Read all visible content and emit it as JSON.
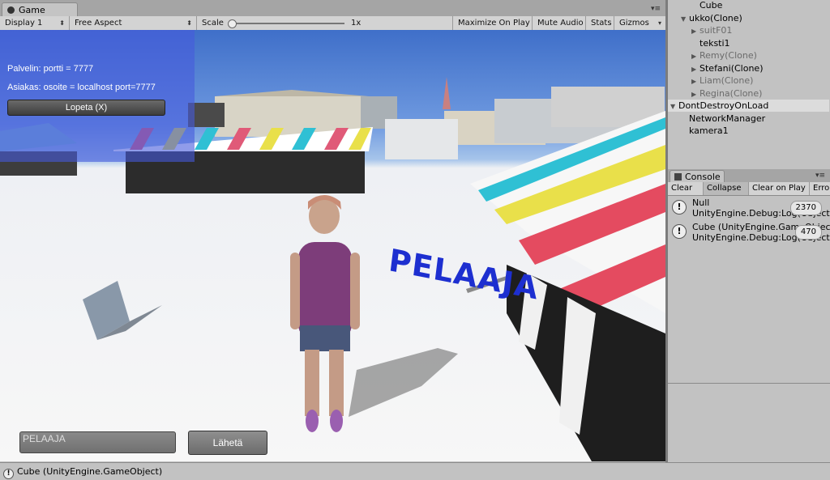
{
  "game_window": {
    "tab_label": "Game",
    "toolbar": {
      "display": "Display 1",
      "aspect": "Free Aspect",
      "scale_label": "Scale",
      "scale_value": "1x",
      "maximize": "Maximize On Play",
      "mute": "Mute Audio",
      "stats": "Stats",
      "gizmos": "Gizmos"
    }
  },
  "game_view": {
    "server_text": "Palvelin: portti = 7777",
    "client_text": "Asiakas: osoite = localhost port=7777",
    "stop_button": "Lopeta (X)",
    "name_input_value": "PELAAJA",
    "send_button": "Lähetä",
    "world_label": "PELAAJA"
  },
  "hierarchy": {
    "items": [
      {
        "label": "Cube",
        "arrow": "",
        "dim": false
      },
      {
        "label": "ukko(Clone)",
        "arrow": "▼",
        "dim": false
      },
      {
        "label": "suitF01",
        "arrow": "▶",
        "dim": true
      },
      {
        "label": "teksti1",
        "arrow": "",
        "dim": false
      },
      {
        "label": "Remy(Clone)",
        "arrow": "▶",
        "dim": true
      },
      {
        "label": "Stefani(Clone)",
        "arrow": "▶",
        "dim": false
      },
      {
        "label": "Liam(Clone)",
        "arrow": "▶",
        "dim": true
      },
      {
        "label": "Regina(Clone)",
        "arrow": "▶",
        "dim": true
      },
      {
        "label": "DontDestroyOnLoad",
        "arrow": "▼",
        "dim": false
      },
      {
        "label": "NetworkManager",
        "arrow": "",
        "dim": false
      },
      {
        "label": "kamera1",
        "arrow": "",
        "dim": false
      }
    ]
  },
  "console": {
    "tab_label": "Console",
    "toolbar": {
      "clear": "Clear",
      "collapse": "Collapse",
      "clear_on_play": "Clear on Play",
      "error_pause": "Erro"
    },
    "logs": [
      {
        "line1": "Null",
        "line2": "UnityEngine.Debug:Log(Object)",
        "count": "2370"
      },
      {
        "line1": "Cube (UnityEngine.GameObject)",
        "line2": "UnityEngine.Debug:Log(Object)",
        "count": "470"
      }
    ]
  },
  "status_bar": {
    "message": "Cube (UnityEngine.GameObject)"
  },
  "colors": {
    "gui_panel": "#465ADC",
    "world_label": "#1D2FD0"
  }
}
